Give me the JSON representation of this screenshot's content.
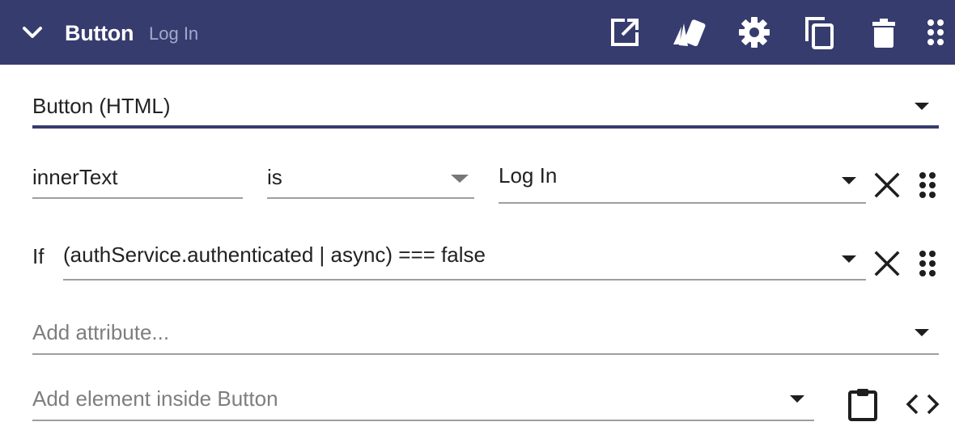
{
  "header": {
    "title": "Button",
    "subtitle": "Log In",
    "bg_color": "#363c6e",
    "icons": [
      "chevron-down-icon",
      "open-in-new-icon",
      "style-icon",
      "gear-icon",
      "duplicate-icon",
      "delete-icon",
      "drag-handle-icon"
    ]
  },
  "element_type": {
    "value": "Button (HTML)"
  },
  "attribute_row": {
    "name": "innerText",
    "operator": "is",
    "value": "Log In"
  },
  "condition_row": {
    "label": "If",
    "expression": "(authService.authenticated | async) === false"
  },
  "add_attribute": {
    "placeholder": "Add attribute..."
  },
  "add_element": {
    "placeholder": "Add element inside Button"
  },
  "colors": {
    "accent": "#363c6e",
    "text": "#222222",
    "placeholder": "#7e7e7e",
    "underline": "#9e9e9e"
  }
}
